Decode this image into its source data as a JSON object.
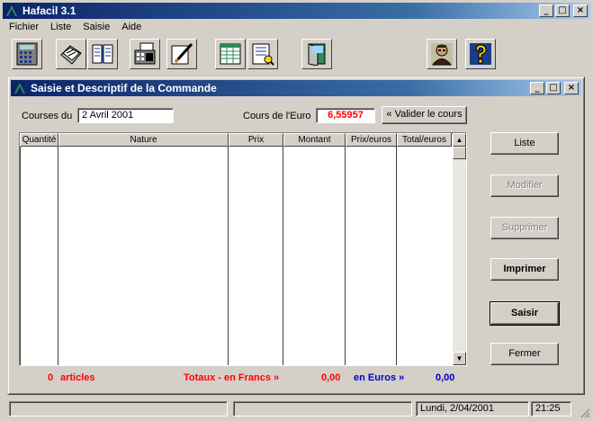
{
  "window": {
    "title": "Hafacil  3.1",
    "controls": [
      "_",
      "□",
      "×"
    ]
  },
  "menu": [
    "Fichier",
    "Liste",
    "Saisie",
    "Aide"
  ],
  "toolbar": [
    {
      "icon": "calculator-icon"
    },
    {
      "icon": "documents-icon"
    },
    {
      "icon": "book-icon"
    },
    {
      "icon": "register-icon"
    },
    {
      "icon": "edit-icon"
    },
    {
      "icon": "spreadsheet-icon"
    },
    {
      "icon": "report-icon"
    },
    {
      "icon": "exit-door-icon"
    },
    {
      "icon": "person-icon"
    },
    {
      "icon": "help-icon"
    }
  ],
  "child": {
    "title": "Saisie et Descriptif de la Commande",
    "courses_label": "Courses du",
    "courses_date": "2 Avril     2001",
    "euro_label": "Cours de l'Euro",
    "euro_value": "6,55957",
    "validate_button": "« Valider le cours",
    "columns": [
      "Quantité",
      "Nature",
      "Prix",
      "Montant",
      "Prix/euros",
      "Total/euros"
    ],
    "buttons": {
      "liste": "Liste",
      "modifier": "Modifier",
      "supprimer": "Supprimer",
      "imprimer": "Imprimer",
      "saisir": "Saisir",
      "fermer": "Fermer"
    },
    "totals": {
      "count": "0",
      "articles": "articles",
      "francs_label": "Totaux - en Francs »",
      "francs_value": "0,00",
      "euros_label": "en Euros »",
      "euros_value": "0,00"
    }
  },
  "status": {
    "date": "Lundi,  2/04/2001",
    "time": "21:25"
  },
  "colors": {
    "title_start": "#0a246a",
    "title_end": "#a6caf0",
    "red": "#ff0000",
    "blue": "#0000cc"
  }
}
